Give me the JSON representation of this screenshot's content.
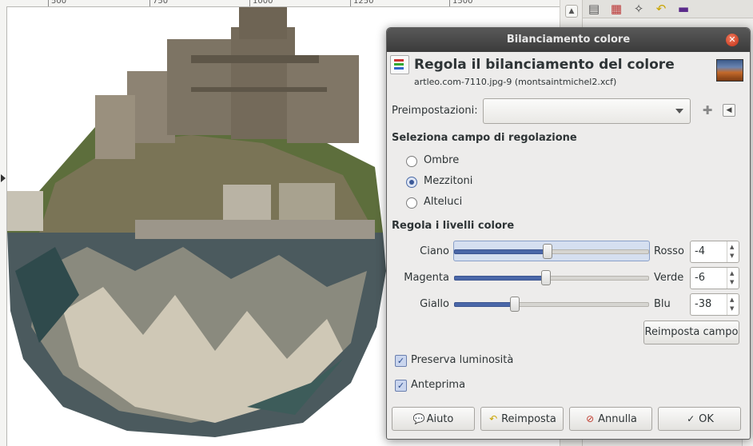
{
  "ruler": {
    "labels": [
      "500",
      "750",
      "1000",
      "1250",
      "1500"
    ]
  },
  "dock": {
    "tab_icons": [
      "layers-icon",
      "channels-icon",
      "paths-icon",
      "undo-icon",
      "colormap-icon"
    ]
  },
  "dialog": {
    "window_title": "Bilanciamento colore",
    "header_title": "Regola il bilanciamento del colore",
    "header_subtitle": "artleo.com-7110.jpg-9 (montsaintmichel2.xcf)",
    "presets": {
      "label": "Preimpostazioni:",
      "value": ""
    },
    "range_section": {
      "title": "Seleziona campo di regolazione",
      "options": [
        "Ombre",
        "Mezzitoni",
        "Alteluci"
      ],
      "selected": "Mezzitoni"
    },
    "levels_section": {
      "title": "Regola i livelli colore",
      "sliders": [
        {
          "left": "Ciano",
          "right": "Rosso",
          "value": "-4",
          "level": -4,
          "focused": true
        },
        {
          "left": "Magenta",
          "right": "Verde",
          "value": "-6",
          "level": -6,
          "focused": false
        },
        {
          "left": "Giallo",
          "right": "Blu",
          "value": "-38",
          "level": -38,
          "focused": false
        }
      ],
      "range": [
        -100,
        100
      ]
    },
    "reset_range_label": "Reimposta campo",
    "preserve_luminosity": {
      "label": "Preserva luminosità",
      "checked": true
    },
    "preview": {
      "label": "Anteprima",
      "checked": true
    },
    "buttons": {
      "help": "Aiuto",
      "reset": "Reimposta",
      "cancel": "Annulla",
      "ok": "OK"
    }
  }
}
